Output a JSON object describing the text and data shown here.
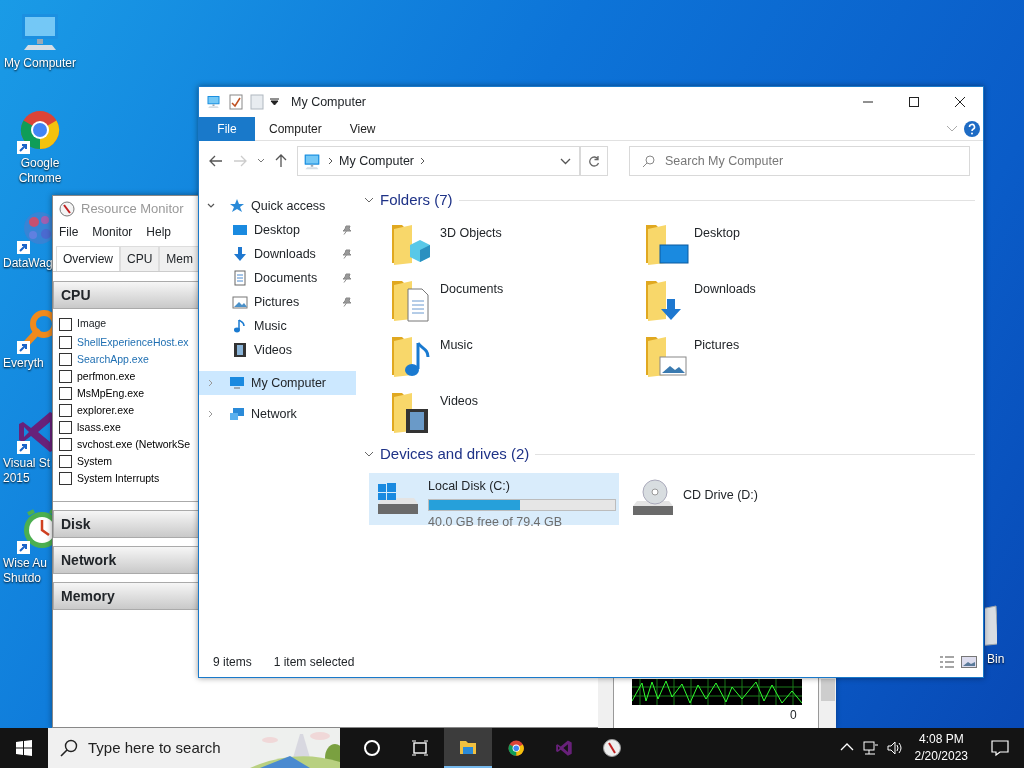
{
  "desktop_icons": [
    {
      "kind": "computer",
      "label": [
        "My Computer"
      ],
      "shortcut": false
    },
    {
      "kind": "chrome",
      "label": [
        "Google",
        "Chrome"
      ],
      "shortcut": true
    },
    {
      "kind": "datawag",
      "label": [
        "DataWag"
      ],
      "shortcut": true
    },
    {
      "kind": "everything",
      "label": [
        "Everyth"
      ],
      "shortcut": true
    },
    {
      "kind": "visualstudio",
      "label": [
        "Visual St",
        "2015"
      ],
      "shortcut": true
    },
    {
      "kind": "wise",
      "label": [
        "Wise Au",
        "Shutdo"
      ],
      "shortcut": true
    }
  ],
  "recycle_bin": {
    "label": "Bin"
  },
  "resource_monitor": {
    "title": "Resource Monitor",
    "menu": [
      "File",
      "Monitor",
      "Help"
    ],
    "tabs": [
      {
        "label": "Overview",
        "selected": true
      },
      {
        "label": "CPU",
        "selected": false
      },
      {
        "label": "Mem",
        "selected": false
      }
    ],
    "sections": [
      {
        "title": "CPU",
        "column": "Image",
        "column_checked": false,
        "processes": [
          {
            "name": "ShellExperienceHost.ex",
            "checked": false,
            "highlighted": true
          },
          {
            "name": "SearchApp.exe",
            "checked": false,
            "highlighted": true
          },
          {
            "name": "perfmon.exe",
            "checked": false,
            "highlighted": false
          },
          {
            "name": "MsMpEng.exe",
            "checked": false,
            "highlighted": false
          },
          {
            "name": "explorer.exe",
            "checked": false,
            "highlighted": false
          },
          {
            "name": "lsass.exe",
            "checked": false,
            "highlighted": false
          },
          {
            "name": "svchost.exe (NetworkSe",
            "checked": false,
            "highlighted": false
          },
          {
            "name": "System",
            "checked": false,
            "highlighted": false
          },
          {
            "name": "System Interrupts",
            "checked": false,
            "highlighted": false
          }
        ]
      },
      {
        "title": "Disk"
      },
      {
        "title": "Network"
      },
      {
        "title": "Memory"
      }
    ],
    "graph_axis_label": "0"
  },
  "explorer": {
    "title": "My Computer",
    "ribbon_tabs": [
      {
        "label": "File",
        "kind": "file"
      },
      {
        "label": "Computer",
        "kind": "tab"
      },
      {
        "label": "View",
        "kind": "tab"
      }
    ],
    "address": "My Computer",
    "search_placeholder": "Search My Computer",
    "navigation": [
      {
        "label": "Quick access",
        "kind": "star",
        "expanded": true,
        "selected": false,
        "children": [
          {
            "label": "Desktop",
            "kind": "desktop",
            "pinned": true,
            "selected": false
          },
          {
            "label": "Downloads",
            "kind": "download",
            "pinned": true,
            "selected": false
          },
          {
            "label": "Documents",
            "kind": "document",
            "pinned": true,
            "selected": false
          },
          {
            "label": "Pictures",
            "kind": "pictures",
            "pinned": true,
            "selected": false
          },
          {
            "label": "Music",
            "kind": "music",
            "pinned": false,
            "selected": false
          },
          {
            "label": "Videos",
            "kind": "video",
            "pinned": false,
            "selected": false
          }
        ]
      },
      {
        "label": "My Computer",
        "kind": "computer",
        "expanded": false,
        "selected": true
      },
      {
        "label": "Network",
        "kind": "network",
        "expanded": false,
        "selected": false
      }
    ],
    "groups": [
      {
        "title": "Folders (7)",
        "expanded": true,
        "items": [
          {
            "label": "3D Objects",
            "kind": "cube",
            "selected": false
          },
          {
            "label": "Desktop",
            "kind": "desktop",
            "selected": false
          },
          {
            "label": "Documents",
            "kind": "document",
            "selected": false
          },
          {
            "label": "Downloads",
            "kind": "download",
            "selected": false
          },
          {
            "label": "Music",
            "kind": "music",
            "selected": false
          },
          {
            "label": "Pictures",
            "kind": "pictures",
            "selected": false
          },
          {
            "label": "Videos",
            "kind": "video",
            "selected": false
          }
        ]
      },
      {
        "title": "Devices and drives (2)",
        "expanded": true,
        "items": [
          {
            "label": "Local Disk (C:)",
            "kind": "disk",
            "level": 0.49,
            "detail": "40.0 GB free of 79.4 GB",
            "selected": true
          },
          {
            "label": "CD Drive (D:)",
            "kind": "cd",
            "selected": false
          }
        ]
      }
    ],
    "status": {
      "item_count": "9 items",
      "selection": "1 item selected"
    }
  },
  "taskbar": {
    "search_placeholder": "Type here to search",
    "apps": [
      {
        "kind": "cortana",
        "active": false
      },
      {
        "kind": "taskview",
        "active": false
      },
      {
        "kind": "explorer",
        "active": true
      },
      {
        "kind": "chrome",
        "active": false
      },
      {
        "kind": "visualstudio",
        "active": false
      },
      {
        "kind": "resmon",
        "active": false
      }
    ],
    "time": "4:08 PM",
    "date": "2/20/2023"
  }
}
